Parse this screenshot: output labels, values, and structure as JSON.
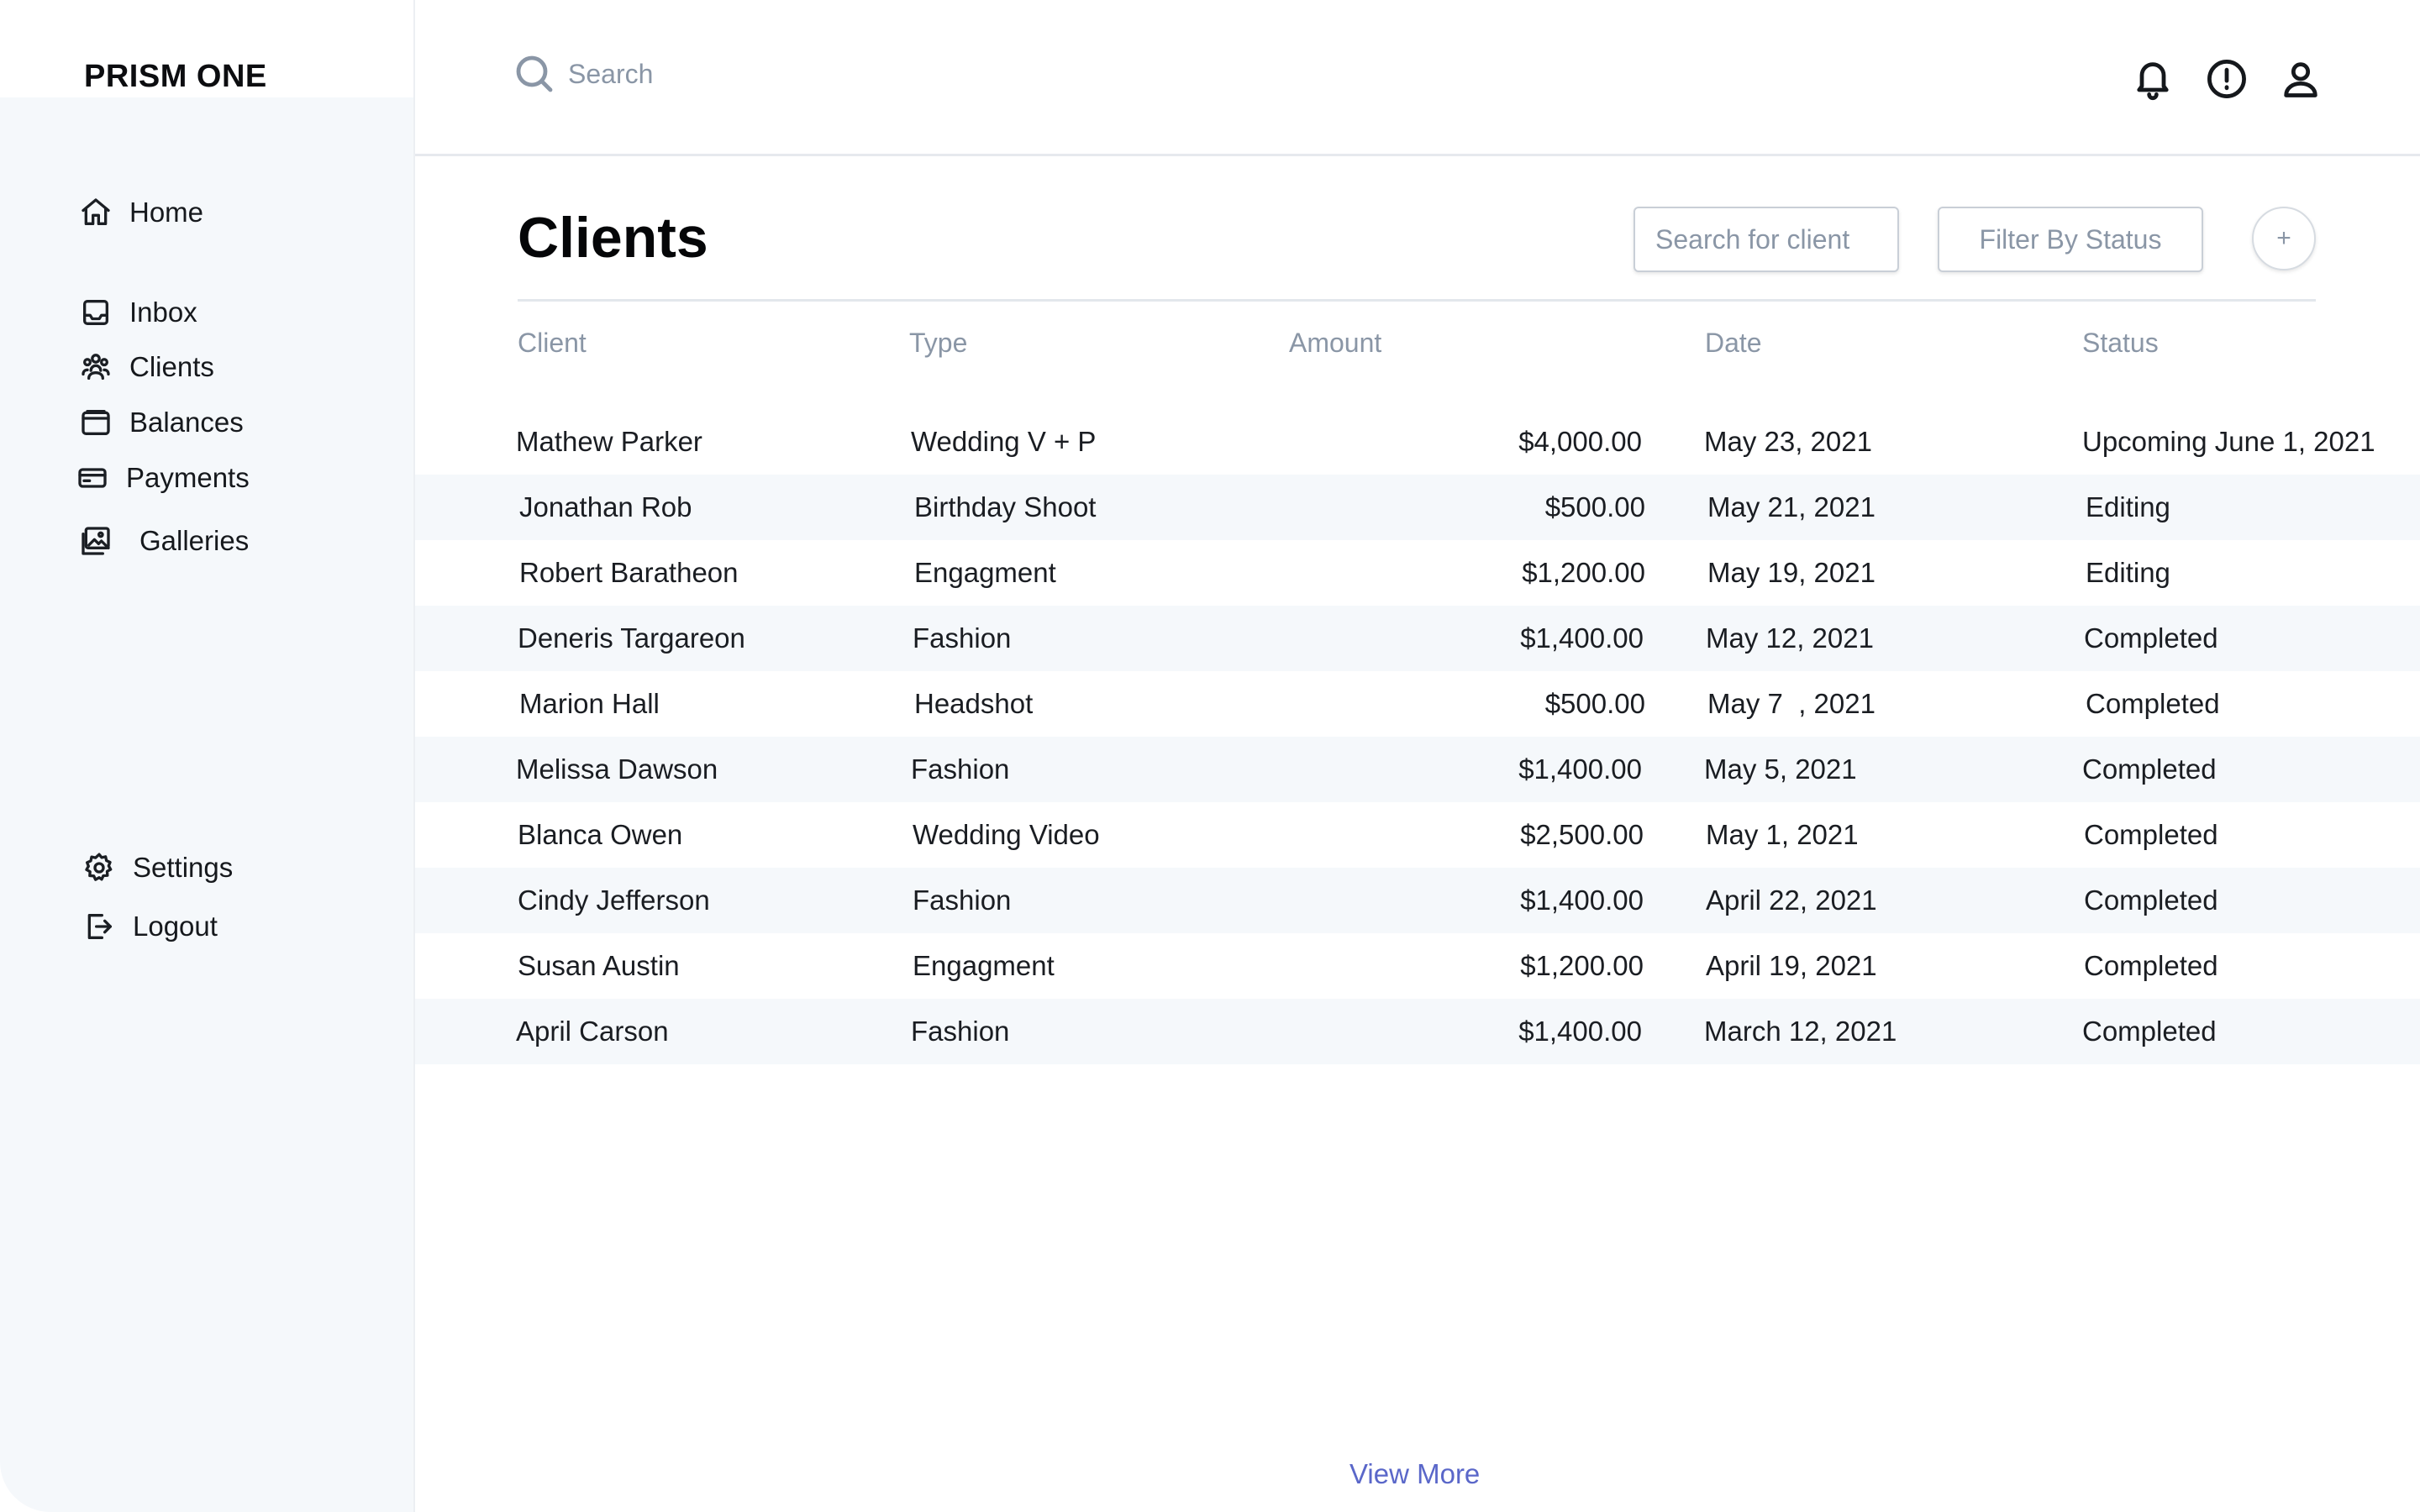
{
  "app": {
    "brand": "PRISM ONE"
  },
  "sidebar": {
    "items": [
      {
        "label": "Home",
        "icon": "home-icon"
      },
      {
        "label": "Inbox",
        "icon": "inbox-icon"
      },
      {
        "label": "Clients",
        "icon": "clients-icon"
      },
      {
        "label": "Balances",
        "icon": "wallet-icon"
      },
      {
        "label": "Payments",
        "icon": "credit-card-icon"
      },
      {
        "label": "Galleries",
        "icon": "gallery-icon"
      },
      {
        "label": "Settings",
        "icon": "gear-icon"
      },
      {
        "label": "Logout",
        "icon": "logout-icon"
      }
    ]
  },
  "topbar": {
    "search_placeholder": "Search",
    "icons": [
      "bell-icon",
      "alert-icon",
      "user-icon"
    ]
  },
  "main": {
    "title": "Clients",
    "client_search_placeholder": "Search for client",
    "filter_label": "Filter By Status",
    "add_label": "+",
    "view_more": "View More"
  },
  "table": {
    "headers": {
      "client": "Client",
      "type": "Type",
      "amount": "Amount",
      "date": "Date",
      "status": "Status"
    },
    "rows": [
      {
        "client": "Mathew Parker",
        "type": "Wedding V + P",
        "amount": "$4,000.00",
        "date": "May 23, 2021",
        "status": "Upcoming June 1, 2021"
      },
      {
        "client": "Jonathan Rob",
        "type": "Birthday Shoot",
        "amount": "$500.00",
        "date": "May 21, 2021",
        "status": "Editing"
      },
      {
        "client": "Robert Baratheon",
        "type": "Engagment",
        "amount": "$1,200.00",
        "date": "May 19, 2021",
        "status": "Editing"
      },
      {
        "client": "Deneris Targareon",
        "type": "Fashion",
        "amount": "$1,400.00",
        "date": "May 12, 2021",
        "status": "Completed"
      },
      {
        "client": "Marion Hall",
        "type": "Headshot",
        "amount": "$500.00",
        "date": "May 7  , 2021",
        "status": "Completed"
      },
      {
        "client": "Melissa Dawson",
        "type": "Fashion",
        "amount": "$1,400.00",
        "date": "May 5, 2021",
        "status": "Completed"
      },
      {
        "client": "Blanca Owen",
        "type": "Wedding Video",
        "amount": "$2,500.00",
        "date": "May 1, 2021",
        "status": "Completed"
      },
      {
        "client": "Cindy Jefferson",
        "type": "Fashion",
        "amount": "$1,400.00",
        "date": "April 22, 2021",
        "status": "Completed"
      },
      {
        "client": "Susan Austin",
        "type": "Engagment",
        "amount": "$1,200.00",
        "date": "April 19, 2021",
        "status": "Completed"
      },
      {
        "client": "April Carson",
        "type": "Fashion",
        "amount": "$1,400.00",
        "date": "March 12, 2021",
        "status": "Completed"
      }
    ]
  },
  "colors": {
    "sidebar_bg": "#f5f8fb",
    "row_alt_bg": "#f5f8fb",
    "muted_text": "#8a96a6",
    "link": "#5a67c9"
  }
}
